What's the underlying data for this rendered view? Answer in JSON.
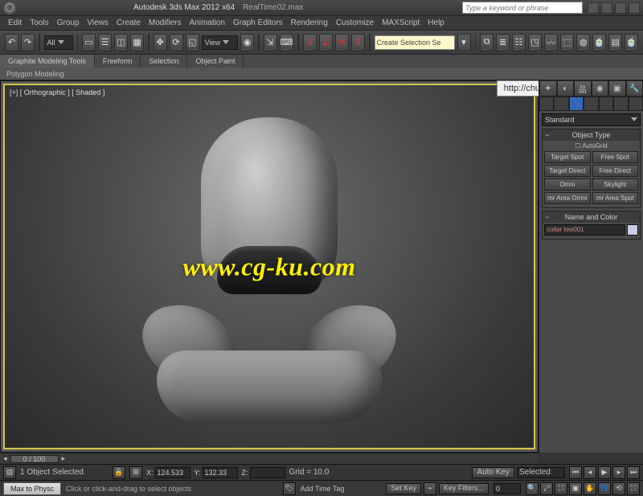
{
  "titlebar": {
    "title": "Autodesk 3ds Max 2012 x64",
    "filename": "RealTime02.max",
    "search_placeholder": "Type a keyword or phrase"
  },
  "menubar": [
    "Edit",
    "Tools",
    "Group",
    "Views",
    "Create",
    "Modifiers",
    "Animation",
    "Graph Editors",
    "Rendering",
    "Customize",
    "MAXScript",
    "Help"
  ],
  "toolbar": {
    "dropdown1_label": "All",
    "view_label": "View",
    "create_sel_label": "Create Selection Se"
  },
  "ribbon": {
    "tabs": [
      "Graphite Modeling Tools",
      "Freeform",
      "Selection",
      "Object Paint"
    ],
    "subtitle": "Polygon Modeling"
  },
  "viewport": {
    "label": "[+] [ Orthographic ] [ Shaded ]"
  },
  "watermark": "www.cg-ku.com",
  "url_overlay": "http://chungkan.wix.com/portfolio",
  "command_panel": {
    "category_dd": "Standard",
    "rollouts": {
      "object_type": {
        "title": "Object Type",
        "autogrid_label": "AutoGrid",
        "buttons": [
          [
            "Target Spot",
            "Free Spot"
          ],
          [
            "Target Direct",
            "Free Direct"
          ],
          [
            "Omni",
            "Skylight"
          ],
          [
            "mr Area Omni",
            "mr Area Spot"
          ]
        ]
      },
      "name_color": {
        "title": "Name and Color",
        "object_name": "collar low001"
      }
    }
  },
  "timeslider": {
    "range_label": "0 / 100",
    "handle": "0 / 100"
  },
  "trackbar": {
    "x_label": "X:",
    "x_value": "124.533",
    "y_label": "Y:",
    "y_value": "132.33",
    "z_label": "Z:",
    "z_value": "",
    "grid_label": "Grid = 10.0",
    "objects_selected": "1 Object Selected"
  },
  "statusbar": {
    "max_btn": "Max to Physc",
    "hint": "Click or click-and-drag to select objects",
    "add_time_tag": "Add Time Tag",
    "auto_key_label": "Auto Key",
    "selected_label": "Selected",
    "set_key_label": "Set Key",
    "key_filters_label": "Key Filters..."
  }
}
